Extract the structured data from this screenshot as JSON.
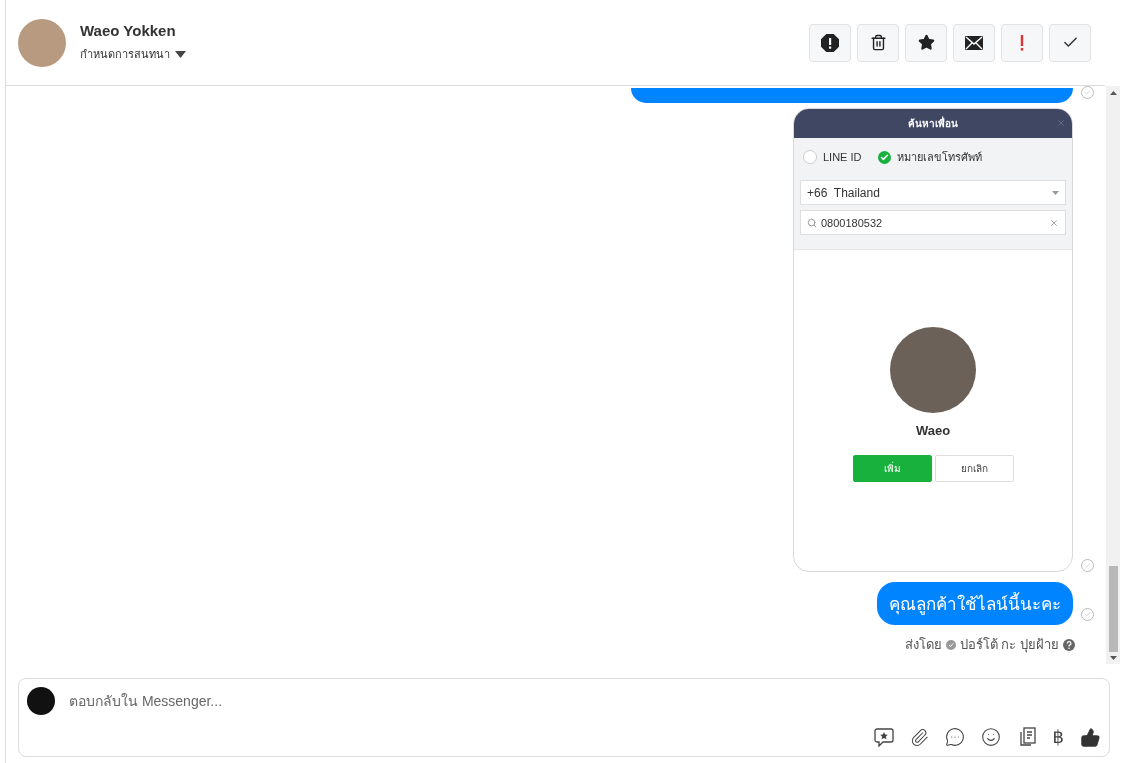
{
  "header": {
    "name": "Waeo Yokken",
    "menu_label": "กำหนดการสนทนา"
  },
  "messages": [
    {
      "kind": "cut"
    },
    {
      "kind": "screenshot",
      "title": "ค้นหาเพื่อน",
      "options": [
        {
          "label": "LINE ID",
          "selected": false
        },
        {
          "label": "หมายเลขโทรศัพท์",
          "selected": true
        }
      ],
      "country": "+66  Thailand",
      "search_value": "0800180532",
      "result_name": "Waeo",
      "buttons": [
        "เพิ่ม",
        "ยกเลิก"
      ]
    },
    {
      "kind": "text",
      "text": "คุณลูกค้าใช้ไลน์นี้นะคะ"
    }
  ],
  "sent_by": {
    "label": "ส่งโดย",
    "agent": "ปอร์โต้ กะ ปุยฝ้าย"
  },
  "composer": {
    "placeholder": "ตอบกลับใน Messenger...",
    "currency_symbol": "฿"
  }
}
